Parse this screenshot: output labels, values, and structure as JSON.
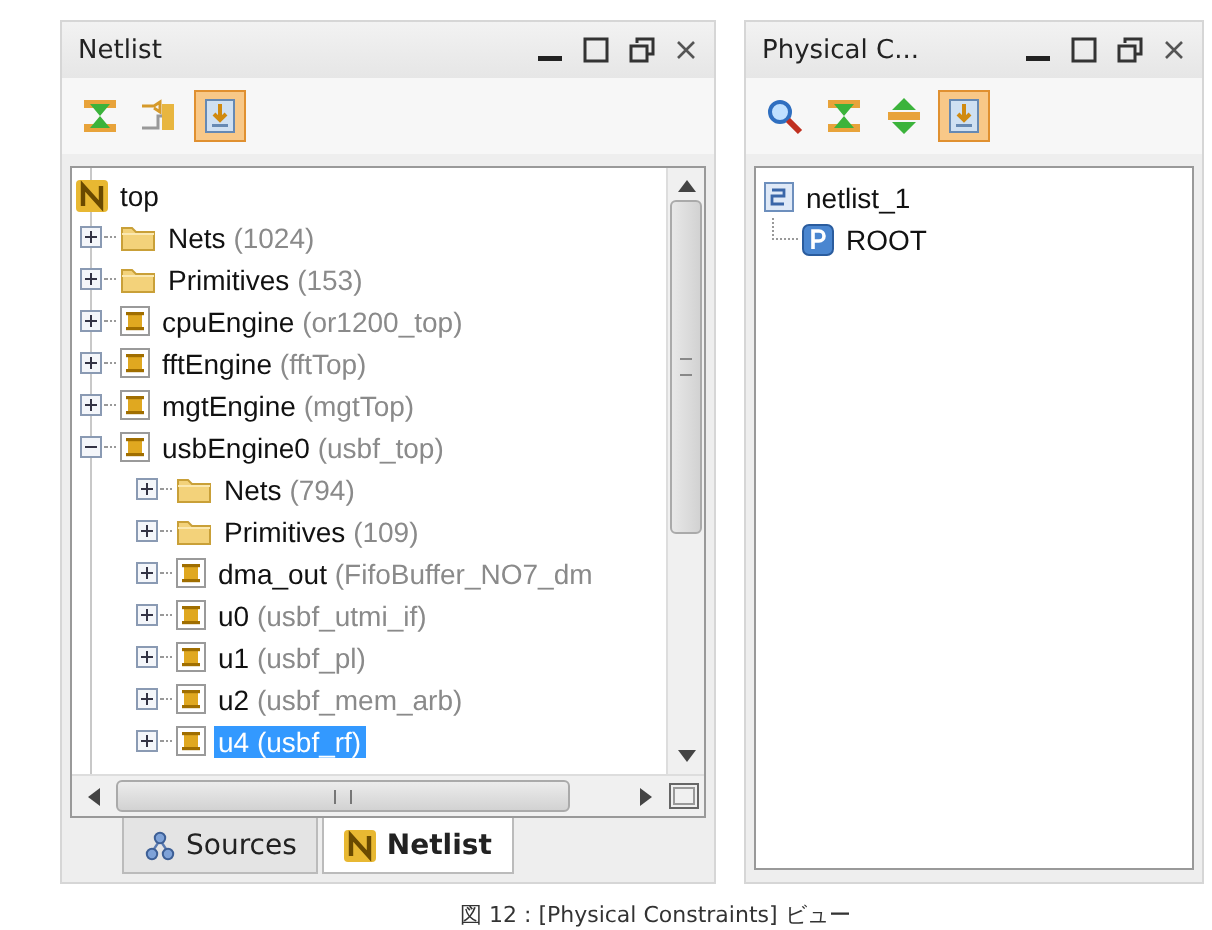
{
  "netlist_panel": {
    "title": "Netlist",
    "toolbar": [
      {
        "kind": "collapse",
        "selected": false
      },
      {
        "kind": "schematic",
        "selected": false
      },
      {
        "kind": "autoscroll",
        "selected": true
      }
    ],
    "tree": [
      {
        "label": "top",
        "kind": "top",
        "selected": false,
        "children": [
          {
            "label": "Nets",
            "detail": "(1024)",
            "kind": "folder",
            "expanded": false,
            "selected": false
          },
          {
            "label": "Primitives",
            "detail": "(153)",
            "kind": "folder",
            "expanded": false,
            "selected": false
          },
          {
            "label": "cpuEngine",
            "detail": "(or1200_top)",
            "kind": "module",
            "expanded": false,
            "selected": false
          },
          {
            "label": "fftEngine",
            "detail": "(fftTop)",
            "kind": "module",
            "expanded": false,
            "selected": false
          },
          {
            "label": "mgtEngine",
            "detail": "(mgtTop)",
            "kind": "module",
            "expanded": false,
            "selected": false
          },
          {
            "label": "usbEngine0",
            "detail": "(usbf_top)",
            "kind": "module",
            "expanded": true,
            "selected": false,
            "children": [
              {
                "label": "Nets",
                "detail": "(794)",
                "kind": "folder",
                "expanded": false,
                "selected": false
              },
              {
                "label": "Primitives",
                "detail": "(109)",
                "kind": "folder",
                "expanded": false,
                "selected": false
              },
              {
                "label": "dma_out",
                "detail": "(FifoBuffer_NO7_dm",
                "kind": "module",
                "expanded": false,
                "selected": false
              },
              {
                "label": "u0",
                "detail": "(usbf_utmi_if)",
                "kind": "module",
                "expanded": false,
                "selected": false
              },
              {
                "label": "u1",
                "detail": "(usbf_pl)",
                "kind": "module",
                "expanded": false,
                "selected": false
              },
              {
                "label": "u2",
                "detail": "(usbf_mem_arb)",
                "kind": "module",
                "expanded": false,
                "selected": false
              },
              {
                "label": "u4",
                "detail": "(usbf_rf)",
                "kind": "module",
                "expanded": false,
                "selected": true
              }
            ]
          }
        ]
      }
    ],
    "tabs": [
      {
        "label": "Sources",
        "kind": "sources",
        "selected": false
      },
      {
        "label": "Netlist",
        "kind": "netlist",
        "selected": true
      }
    ]
  },
  "constraints_panel": {
    "title": "Physical C...",
    "toolbar": [
      {
        "kind": "search",
        "selected": false
      },
      {
        "kind": "collapse",
        "selected": false
      },
      {
        "kind": "expand",
        "selected": false
      },
      {
        "kind": "autoscroll",
        "selected": true
      }
    ],
    "tree": [
      {
        "label": "netlist_1",
        "kind": "netlist",
        "children": [
          {
            "label": "ROOT",
            "kind": "pblock"
          }
        ]
      }
    ]
  },
  "caption": "図 12 : [Physical Constraints] ビュー"
}
